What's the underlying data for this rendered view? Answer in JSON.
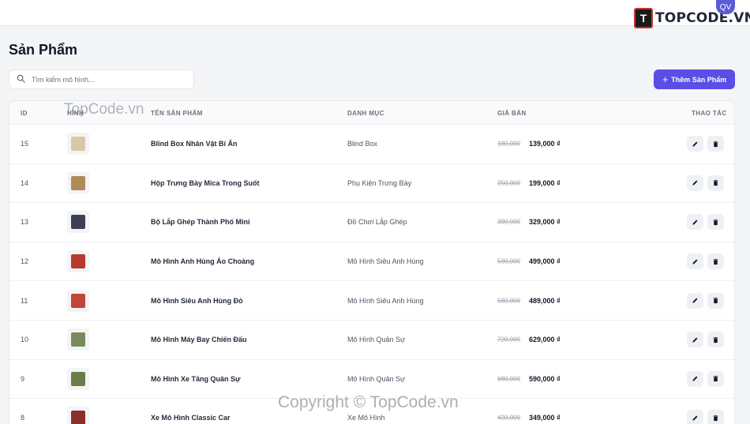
{
  "brand": {
    "name": "TOPCODE.VN",
    "logo_char": "T"
  },
  "user": {
    "initials": "QV"
  },
  "page": {
    "title": "Sản Phẩm"
  },
  "search": {
    "placeholder": "Tìm kiếm mô hình..."
  },
  "actions": {
    "add_label": "Thêm Sản Phẩm"
  },
  "table": {
    "headers": {
      "id": "ID",
      "image": "Hình",
      "name": "Tên sản phẩm",
      "category": "Danh mục",
      "price": "Giá bán",
      "actions": "Thao tác"
    },
    "rows": [
      {
        "id": "15",
        "name": "Blind Box Nhân Vật Bí Ẩn",
        "category": "Blind Box",
        "old_price": "180,000",
        "price": "139,000 ₫",
        "thumb_color": "#d9c8a8"
      },
      {
        "id": "14",
        "name": "Hộp Trưng Bày Mica Trong Suốt",
        "category": "Phụ Kiện Trưng Bày",
        "old_price": "250,000",
        "price": "199,000 ₫",
        "thumb_color": "#b08a5a"
      },
      {
        "id": "13",
        "name": "Bộ Lắp Ghép Thành Phố Mini",
        "category": "Đồ Chơi Lắp Ghép",
        "old_price": "390,000",
        "price": "329,000 ₫",
        "thumb_color": "#3c3f56"
      },
      {
        "id": "12",
        "name": "Mô Hình Anh Hùng Áo Choàng",
        "category": "Mô Hình Siêu Anh Hùng",
        "old_price": "590,000",
        "price": "499,000 ₫",
        "thumb_color": "#b73a2e"
      },
      {
        "id": "11",
        "name": "Mô Hình Siêu Anh Hùng Đỏ",
        "category": "Mô Hình Siêu Anh Hùng",
        "old_price": "560,000",
        "price": "489,000 ₫",
        "thumb_color": "#c0453a"
      },
      {
        "id": "10",
        "name": "Mô Hình Máy Bay Chiến Đấu",
        "category": "Mô Hình Quân Sự",
        "old_price": "720,000",
        "price": "629,000 ₫",
        "thumb_color": "#7b8a5c"
      },
      {
        "id": "9",
        "name": "Mô Hình Xe Tăng Quân Sự",
        "category": "Mô Hình Quân Sự",
        "old_price": "680,000",
        "price": "590,000 ₫",
        "thumb_color": "#6b7d4a"
      },
      {
        "id": "8",
        "name": "Xe Mô Hình Classic Car",
        "category": "Xe Mô Hình",
        "old_price": "420,000",
        "price": "349,000 ₫",
        "thumb_color": "#8b2f2a"
      }
    ]
  },
  "watermarks": {
    "top": "TopCode.vn",
    "bottom": "Copyright © TopCode.vn"
  },
  "colors": {
    "accent": "#5b4de6",
    "background": "#f4f5f7"
  },
  "icons": {
    "search": "search-icon",
    "edit": "pencil-icon",
    "delete": "trash-icon",
    "add": "plus-icon"
  }
}
